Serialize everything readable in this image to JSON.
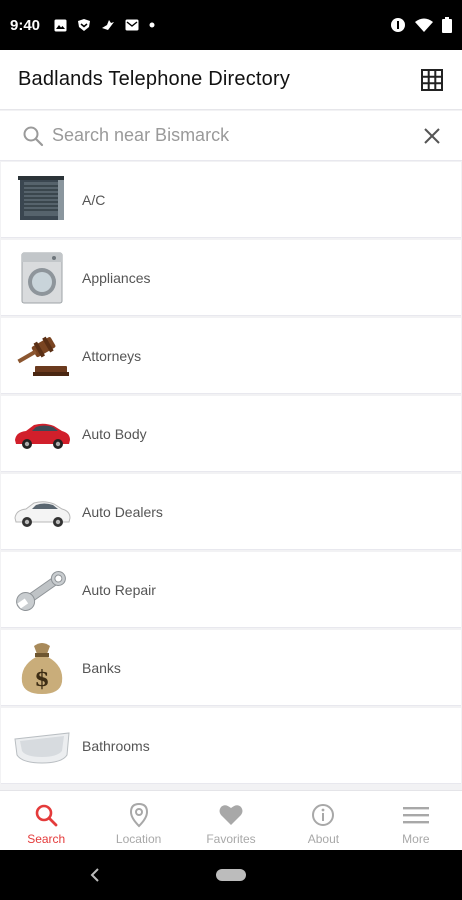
{
  "status_bar": {
    "time": "9:40",
    "icons_left": [
      "image-icon",
      "shield-icon",
      "bird-icon",
      "mail-icon",
      "dot-icon"
    ],
    "icons_right": [
      "sync-icon",
      "wifi-icon",
      "battery-icon"
    ]
  },
  "app_bar": {
    "title": "Badlands Telephone Directory",
    "grid_icon": "grid-icon"
  },
  "search": {
    "placeholder": "Search near Bismarck",
    "value": "",
    "search_icon": "search-icon",
    "clear_icon": "close-icon"
  },
  "categories": [
    {
      "label": "A/C",
      "icon": "ac-unit-icon"
    },
    {
      "label": "Appliances",
      "icon": "washing-machine-icon"
    },
    {
      "label": "Attorneys",
      "icon": "gavel-icon"
    },
    {
      "label": "Auto Body",
      "icon": "red-car-icon"
    },
    {
      "label": "Auto Dealers",
      "icon": "white-car-icon"
    },
    {
      "label": "Auto Repair",
      "icon": "wrench-icon"
    },
    {
      "label": "Banks",
      "icon": "money-bag-icon"
    },
    {
      "label": "Bathrooms",
      "icon": "bathtub-icon"
    }
  ],
  "bottom_nav": {
    "items": [
      {
        "label": "Search",
        "icon": "search-icon",
        "active": true
      },
      {
        "label": "Location",
        "icon": "location-pin-icon",
        "active": false
      },
      {
        "label": "Favorites",
        "icon": "heart-icon",
        "active": false
      },
      {
        "label": "About",
        "icon": "info-icon",
        "active": false
      },
      {
        "label": "More",
        "icon": "menu-icon",
        "active": false
      }
    ]
  },
  "colors": {
    "accent": "#e43b3b",
    "inactive": "#a8a8a8",
    "background": "#f2f2f4"
  }
}
